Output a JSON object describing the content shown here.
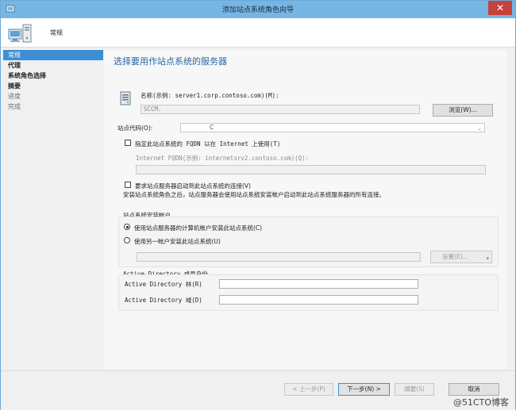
{
  "window": {
    "title": "添加站点系统角色向导",
    "close_glyph": "✕"
  },
  "header": {
    "label": "常规",
    "icon": "computer-icon"
  },
  "sidebar": {
    "items": [
      {
        "label": "常规",
        "state": "active"
      },
      {
        "label": "代理",
        "state": "bold"
      },
      {
        "label": "系统角色选择",
        "state": "bold"
      },
      {
        "label": "摘要",
        "state": "bold"
      },
      {
        "label": "进度",
        "state": "muted"
      },
      {
        "label": "完成",
        "state": "muted"
      }
    ]
  },
  "page": {
    "title": "选择要用作站点系统的服务器",
    "name_label": "名称(示例: server1.corp.contoso.com)(M):",
    "name_value": "SCCM.",
    "browse_button": "浏览(W)...",
    "site_code_label": "站点代码(O):",
    "site_code_value": "C",
    "fqdn_checkbox_label": "指定此站点系统的 FQDN 以在 Internet 上使用(T)",
    "fqdn_checked": false,
    "internet_fqdn_label": "Internet FQDN(示例: internetsrv2.contoso.com)(Q):",
    "internet_fqdn_value": "",
    "require_checkbox_label": "要求站点服务器启动到此站点系统的连接(V)",
    "require_checked": false,
    "require_note": "安装站点系统角色之后，站点服务器会使用站点系统安装帐户启动到此站点系统服务器的所有连接。",
    "install_account": {
      "title": "站点系统安装帐户",
      "radio_computer": "使用站点服务器的计算机帐户安装此站点系统(C)",
      "radio_other": "使用另一帐户安装此站点系统(U)",
      "selected": "computer",
      "account_value": "",
      "set_button": "设置(E)..."
    },
    "ad_membership": {
      "title": "Active Directory 成员身份",
      "forest_label": "Active Directory 林(R)",
      "forest_value": "",
      "domain_label": "Active Directory 域(D)",
      "domain_value": ""
    }
  },
  "footer": {
    "prev_button": "< 上一步(P)",
    "next_button": "下一步(N) >",
    "summary_button": "摘要(S)",
    "cancel_button": "取消",
    "watermark": "@51CTO博客"
  }
}
